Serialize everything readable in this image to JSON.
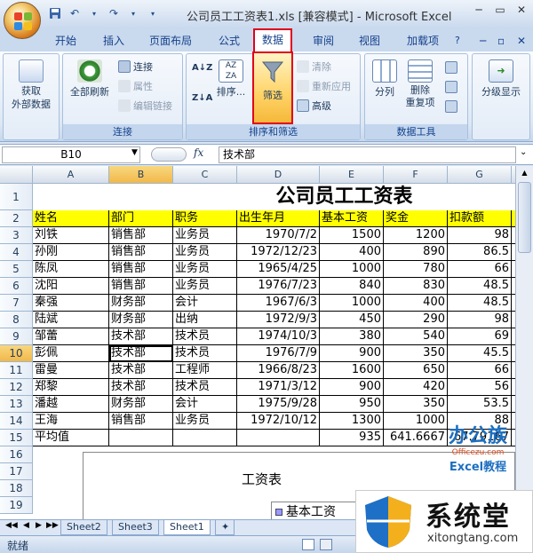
{
  "window": {
    "title": "公司员工工资表1.xls  [兼容模式] - Microsoft Excel"
  },
  "tabs": [
    "开始",
    "插入",
    "页面布局",
    "公式",
    "数据",
    "审阅",
    "视图",
    "加载项"
  ],
  "ribbon": {
    "get_external": "获取\n外部数据",
    "refresh_all": "全部刷新",
    "connections": "连接",
    "properties": "属性",
    "edit_links": "编辑链接",
    "connections_group": "连接",
    "sort": "排序...",
    "filter": "筛选",
    "clear": "清除",
    "reapply": "重新应用",
    "advanced": "高级",
    "sort_filter_group": "排序和筛选",
    "split": "分列",
    "remove_dup": "删除\n重复项",
    "data_tools_group": "数据工具",
    "outline": "分级显示",
    "az_up": "A↓Z",
    "az_big": "AZ ZA"
  },
  "formula_bar": {
    "name_box": "B10",
    "fx": "fx",
    "content": "技术部"
  },
  "columns": [
    "A",
    "B",
    "C",
    "D",
    "E",
    "F",
    "G",
    "H"
  ],
  "sheet_title": "公司员工工资表",
  "headers": [
    "姓名",
    "部门",
    "职务",
    "出生年月",
    "基本工资",
    "奖金",
    "扣款额",
    ""
  ],
  "rows": [
    [
      "刘铁",
      "销售部",
      "业务员",
      "1970/7/2",
      "1500",
      "1200",
      "98"
    ],
    [
      "孙刚",
      "销售部",
      "业务员",
      "1972/12/23",
      "400",
      "890",
      "86.5"
    ],
    [
      "陈凤",
      "销售部",
      "业务员",
      "1965/4/25",
      "1000",
      "780",
      "66"
    ],
    [
      "沈阳",
      "销售部",
      "业务员",
      "1976/7/23",
      "840",
      "830",
      "48.5"
    ],
    [
      "秦强",
      "财务部",
      "会计",
      "1967/6/3",
      "1000",
      "400",
      "48.5"
    ],
    [
      "陆斌",
      "财务部",
      "出纳",
      "1972/9/3",
      "450",
      "290",
      "98"
    ],
    [
      "邹蕾",
      "技术部",
      "技术员",
      "1974/10/3",
      "380",
      "540",
      "69"
    ],
    [
      "彭佩",
      "技术部",
      "技术员",
      "1976/7/9",
      "900",
      "350",
      "45.5"
    ],
    [
      "雷曼",
      "技术部",
      "工程师",
      "1966/8/23",
      "1600",
      "650",
      "66"
    ],
    [
      "郑黎",
      "技术部",
      "技术员",
      "1971/3/12",
      "900",
      "420",
      "56"
    ],
    [
      "潘越",
      "财务部",
      "会计",
      "1975/9/28",
      "950",
      "350",
      "53.5"
    ],
    [
      "王海",
      "销售部",
      "业务员",
      "1972/10/12",
      "1300",
      "1000",
      "88"
    ],
    [
      "平均值",
      "",
      "",
      "",
      "935",
      "641.6667",
      "67.79167"
    ]
  ],
  "row_numbers": [
    "1",
    "2",
    "3",
    "4",
    "5",
    "6",
    "7",
    "8",
    "9",
    "10",
    "11",
    "12",
    "13",
    "14",
    "15",
    "16",
    "17",
    "18",
    "19"
  ],
  "chart": {
    "title": "工资表",
    "legend": "基本工资"
  },
  "sheet_tabs": [
    "Sheet2",
    "Sheet3",
    "Sheet1"
  ],
  "status": "就绪",
  "watermark": {
    "brand1": "办公族",
    "brand1_url": "Officezu.com",
    "brand1_sub": "Excel教程",
    "brand2": "系统堂",
    "brand2_url": "xitongtang.com"
  },
  "colors": {
    "header_yellow": "#ffff00",
    "highlight_red": "#e1001a",
    "ribbon_blue": "#15428b"
  }
}
